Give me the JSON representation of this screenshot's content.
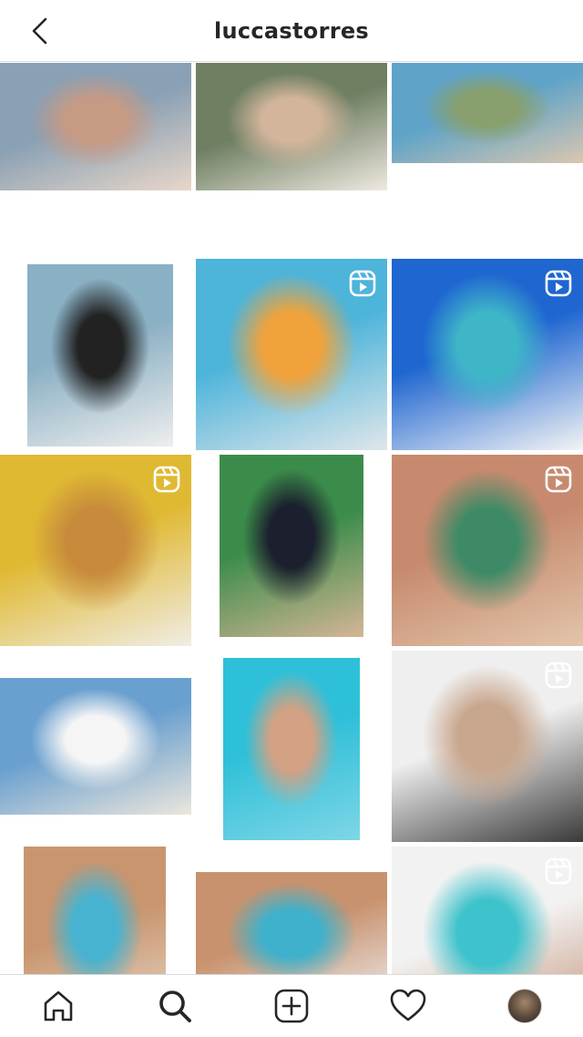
{
  "header": {
    "username": "luccastorres"
  },
  "grid": {
    "tiles": [
      {
        "name": "post-1",
        "type": "photo",
        "colors": [
          "#8aa0b4",
          "#c79a84",
          "#e8d7c9"
        ]
      },
      {
        "name": "post-2",
        "type": "photo",
        "colors": [
          "#6e7f62",
          "#d2b59b",
          "#efe9e1"
        ]
      },
      {
        "name": "post-3",
        "type": "photo",
        "colors": [
          "#5fa3c8",
          "#88a06d",
          "#d9c7b0"
        ]
      },
      {
        "name": "post-4",
        "type": "photo",
        "colors": [
          "#8ab0c4",
          "#222222",
          "#eeeeee"
        ]
      },
      {
        "name": "post-5",
        "type": "reel",
        "colors": [
          "#4db4da",
          "#f0a33c",
          "#dfe6ea"
        ]
      },
      {
        "name": "post-6",
        "type": "reel",
        "colors": [
          "#1f66d1",
          "#3fb6c8",
          "#f4f4f4"
        ]
      },
      {
        "name": "post-7",
        "type": "reel",
        "colors": [
          "#e0b933",
          "#c78b3b",
          "#f0ede6"
        ]
      },
      {
        "name": "post-8",
        "type": "photo",
        "colors": [
          "#3b8c4a",
          "#1b1f2e",
          "#d5b597"
        ]
      },
      {
        "name": "post-9",
        "type": "reel",
        "colors": [
          "#c78a6e",
          "#3f8a66",
          "#e2c5ac"
        ]
      },
      {
        "name": "post-10",
        "type": "photo",
        "colors": [
          "#6aa0cf",
          "#f5f5f5",
          "#ece6dc"
        ]
      },
      {
        "name": "post-11",
        "type": "photo",
        "colors": [
          "#2fc0d9",
          "#d3a183",
          "#7fd6e6"
        ]
      },
      {
        "name": "post-12",
        "type": "reel",
        "colors": [
          "#efefef",
          "#c9a78e",
          "#3a3a3a"
        ]
      },
      {
        "name": "post-13",
        "type": "photo",
        "colors": [
          "#c9956f",
          "#48b3d0",
          "#e6d8c8"
        ]
      },
      {
        "name": "post-14",
        "type": "photo",
        "colors": [
          "#c8926e",
          "#3fb1cc",
          "#ececec"
        ]
      },
      {
        "name": "post-15",
        "type": "reel",
        "colors": [
          "#f2f2f2",
          "#3ec2cc",
          "#c28f72"
        ]
      }
    ]
  },
  "nav": {
    "items": [
      {
        "name": "home",
        "icon": "home-icon"
      },
      {
        "name": "search",
        "icon": "search-icon"
      },
      {
        "name": "create",
        "icon": "plus-square-icon"
      },
      {
        "name": "activity",
        "icon": "heart-icon"
      },
      {
        "name": "profile",
        "icon": "avatar"
      }
    ]
  }
}
